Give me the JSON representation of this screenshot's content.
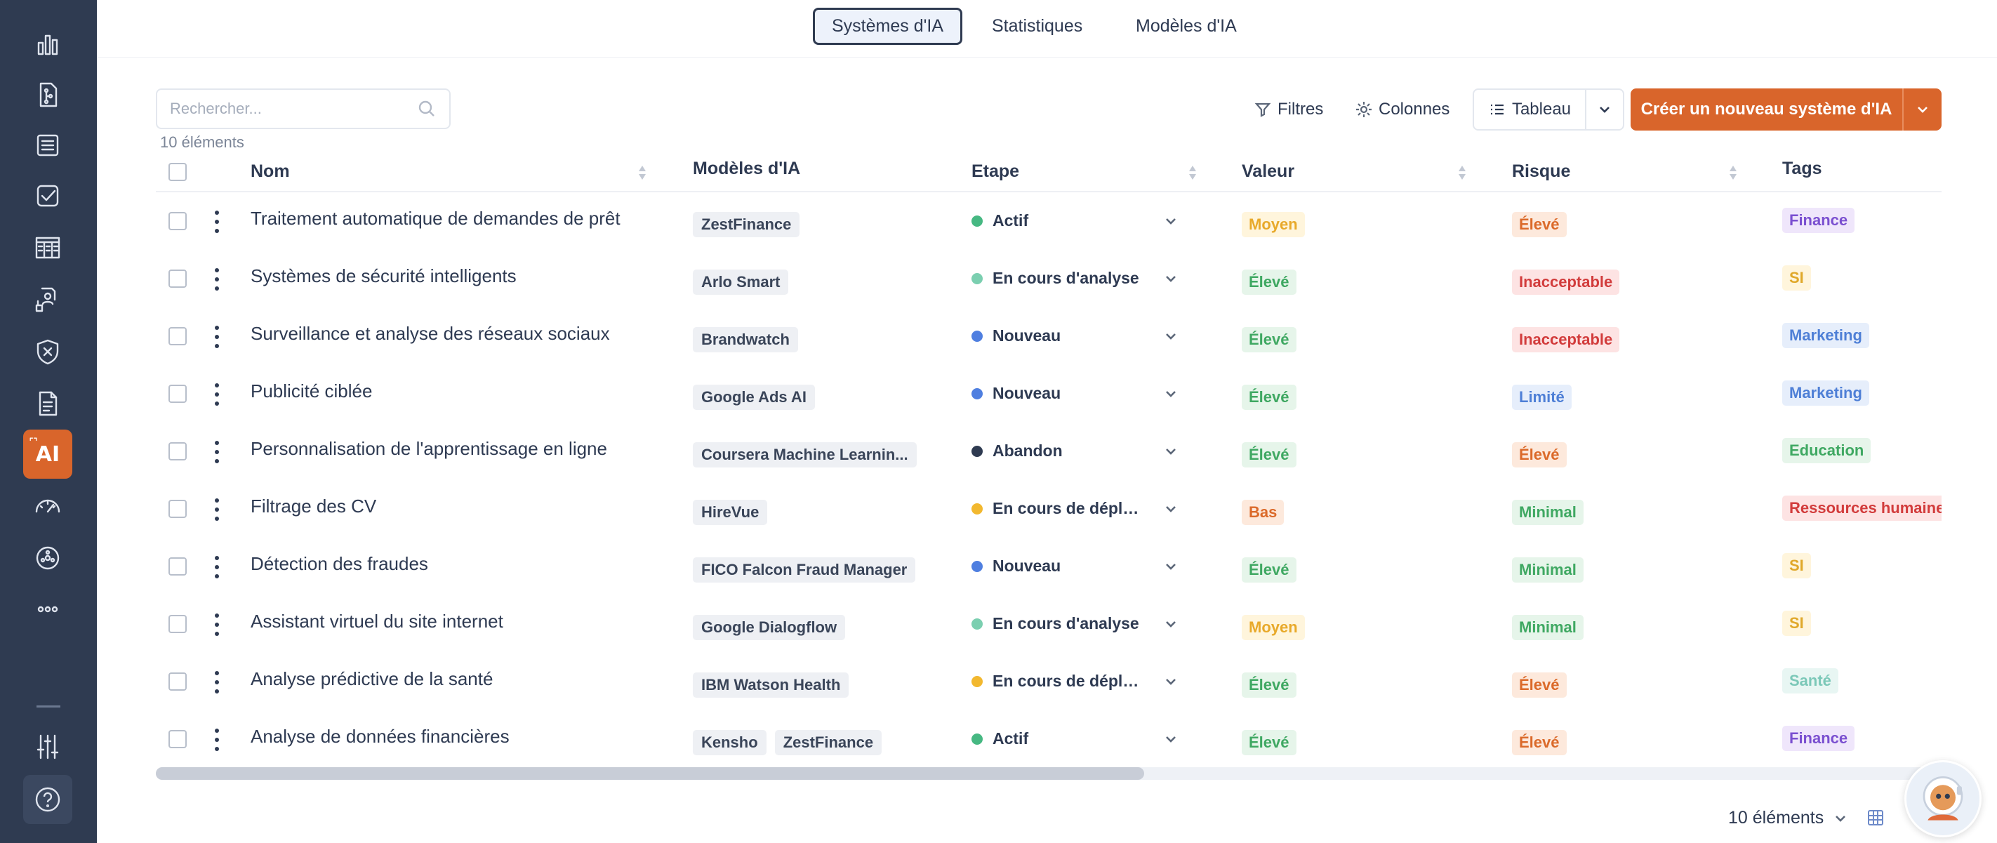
{
  "sidebar": {
    "items": [
      {
        "icon": "bar-chart-icon"
      },
      {
        "icon": "document-tree-icon"
      },
      {
        "icon": "database-list-icon"
      },
      {
        "icon": "checklist-icon"
      },
      {
        "icon": "table-grid-icon"
      },
      {
        "icon": "org-chart-icon"
      },
      {
        "icon": "shield-x-icon"
      },
      {
        "icon": "file-text-icon"
      },
      {
        "icon": "ai-icon",
        "label": "AI",
        "active": true
      },
      {
        "icon": "gauge-icon"
      },
      {
        "icon": "settings-wheel-icon"
      },
      {
        "icon": "more-icon"
      }
    ],
    "bottom": [
      {
        "icon": "sliders-icon"
      },
      {
        "icon": "help-icon"
      }
    ]
  },
  "tabs": [
    "Systèmes d'IA",
    "Statistiques",
    "Modèles d'IA"
  ],
  "toolbar": {
    "search_placeholder": "Rechercher...",
    "count": "10 éléments",
    "filters": "Filtres",
    "columns": "Colonnes",
    "view": "Tableau",
    "create": "Créer un nouveau système d'IA"
  },
  "columns": {
    "name": "Nom",
    "models": "Modèles d'IA",
    "stage": "Etape",
    "value": "Valeur",
    "risk": "Risque",
    "tags": "Tags"
  },
  "rows": [
    {
      "name": "Traitement automatique de demandes de prêt",
      "models": [
        "ZestFinance"
      ],
      "stage": "Actif",
      "value": "Moyen",
      "risk": "Élevé",
      "tag": "Finance"
    },
    {
      "name": "Systèmes de sécurité intelligents",
      "models": [
        "Arlo Smart"
      ],
      "stage": "En cours d'analyse",
      "value": "Élevé",
      "risk": "Inacceptable",
      "tag": "SI"
    },
    {
      "name": "Surveillance et analyse des réseaux sociaux",
      "models": [
        "Brandwatch"
      ],
      "stage": "Nouveau",
      "value": "Élevé",
      "risk": "Inacceptable",
      "tag": "Marketing"
    },
    {
      "name": "Publicité ciblée",
      "models": [
        "Google Ads AI"
      ],
      "stage": "Nouveau",
      "value": "Élevé",
      "risk": "Limité",
      "tag": "Marketing"
    },
    {
      "name": "Personnalisation de l'apprentissage en ligne",
      "models": [
        "Coursera Machine Learnin..."
      ],
      "stage": "Abandon",
      "value": "Élevé",
      "risk": "Élevé",
      "tag": "Education"
    },
    {
      "name": "Filtrage des CV",
      "models": [
        "HireVue"
      ],
      "stage": "En cours de déploi...",
      "value": "Bas",
      "risk": "Minimal",
      "tag": "Ressources humaines"
    },
    {
      "name": "Détection des fraudes",
      "models": [
        "FICO Falcon Fraud Manager"
      ],
      "stage": "Nouveau",
      "value": "Élevé",
      "risk": "Minimal",
      "tag": "SI"
    },
    {
      "name": "Assistant virtuel du site internet",
      "models": [
        "Google Dialogflow"
      ],
      "stage": "En cours d'analyse",
      "value": "Moyen",
      "risk": "Minimal",
      "tag": "SI"
    },
    {
      "name": "Analyse prédictive de la santé",
      "models": [
        "IBM Watson Health"
      ],
      "stage": "En cours de déploi...",
      "value": "Élevé",
      "risk": "Élevé",
      "tag": "Santé"
    },
    {
      "name": "Analyse de données financières",
      "models": [
        "Kensho",
        "ZestFinance"
      ],
      "stage": "Actif",
      "value": "Élevé",
      "risk": "Élevé",
      "tag": "Finance"
    }
  ],
  "footer": {
    "count": "10 éléments"
  },
  "colors": {
    "sidebar": "#2f3b51",
    "accent": "#d9652b",
    "stages": {
      "Actif": "#46b882",
      "En cours d'analyse": "#7bcfb0",
      "Nouveau": "#4f7fe0",
      "Abandon": "#2f3b51",
      "En cours de déploi...": "#f2b82f"
    },
    "levels": {
      "Moyen": {
        "bg": "#fff5dc",
        "fg": "#e8a92a"
      },
      "Élevé-value": {
        "bg": "#e6f5ea",
        "fg": "#3fa862"
      },
      "Bas": {
        "bg": "#fde9dc",
        "fg": "#db6a2a"
      },
      "Élevé-risk": {
        "bg": "#fde9dc",
        "fg": "#db6a2a"
      },
      "Inacceptable": {
        "bg": "#fde3e3",
        "fg": "#d23c3c"
      },
      "Limité": {
        "bg": "#e6eefb",
        "fg": "#4e7fd6"
      },
      "Minimal": {
        "bg": "#e6f5ea",
        "fg": "#3fa862"
      }
    },
    "tags": {
      "Finance": {
        "bg": "#efe6fb",
        "fg": "#7a4fd0"
      },
      "SI": {
        "bg": "#fff5dc",
        "fg": "#e0a82a"
      },
      "Marketing": {
        "bg": "#e6eefb",
        "fg": "#4e7fd6"
      },
      "Education": {
        "bg": "#e6f5ea",
        "fg": "#3fa862"
      },
      "Ressources humaines": {
        "bg": "#fde3e3",
        "fg": "#d23c3c"
      },
      "Santé": {
        "bg": "#e8f6f3",
        "fg": "#7bc8b8"
      }
    }
  }
}
